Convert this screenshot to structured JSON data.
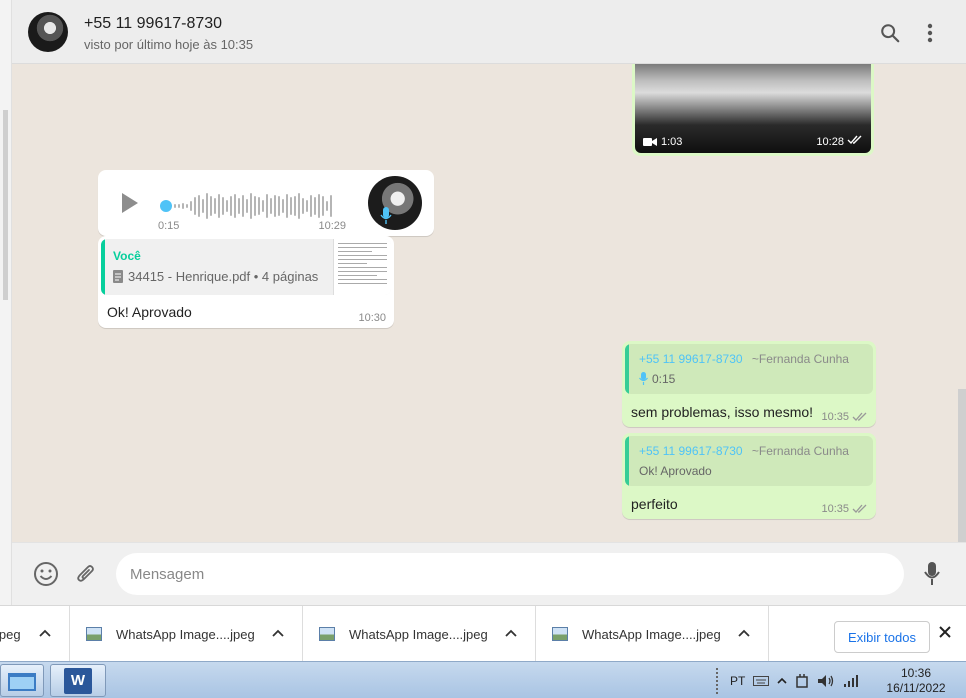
{
  "header": {
    "contact_name": "+55 11 99617-8730",
    "last_seen": "visto por último hoje às 10:35",
    "icons": [
      "search-icon",
      "menu-dots-icon"
    ]
  },
  "messages": {
    "video": {
      "duration": "1:03",
      "time": "10:28",
      "status": "read"
    },
    "audio": {
      "duration": "0:15",
      "time": "10:29",
      "progress": 0.0
    },
    "doc_reply": {
      "quote_author": "Você",
      "quote_file": "34415 - Henrique.pdf • 4 páginas",
      "text": "Ok! Aprovado",
      "time": "10:30"
    },
    "reply1": {
      "quote_number": "+55 11 99617-8730",
      "quote_name": "~Fernanda Cunha",
      "quote_body": "0:15",
      "text": "sem problemas, isso mesmo!",
      "time": "10:35"
    },
    "reply2": {
      "quote_number": "+55 11 99617-8730",
      "quote_name": "~Fernanda Cunha",
      "quote_body": "Ok! Aprovado",
      "text": "perfeito",
      "time": "10:35"
    }
  },
  "composer": {
    "placeholder": "Mensagem",
    "value": ""
  },
  "downloads": {
    "items": [
      "jpeg",
      "WhatsApp Image....jpeg",
      "WhatsApp Image....jpeg",
      "WhatsApp Image....jpeg"
    ],
    "show_all": "Exibir todos"
  },
  "taskbar": {
    "lang": "PT",
    "time": "10:36",
    "date": "16/11/2022"
  },
  "colors": {
    "accent_green": "#06cf9c",
    "outgoing_bubble": "#dcf8c6",
    "incoming_bubble": "#ffffff",
    "link_blue": "#4fc3f7"
  }
}
